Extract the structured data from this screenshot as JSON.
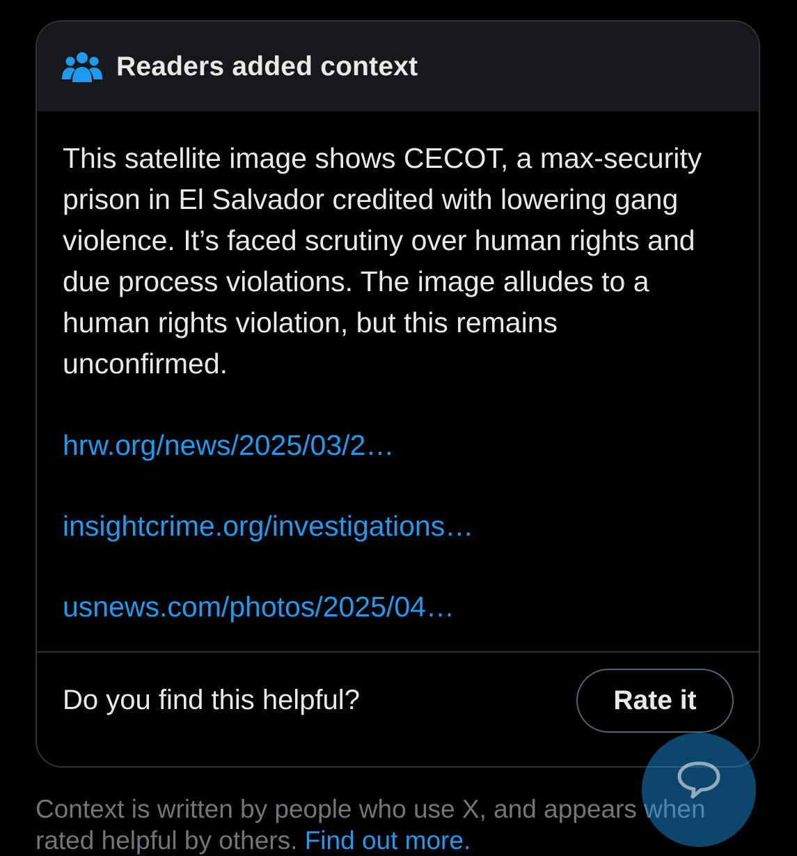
{
  "card": {
    "header": {
      "icon": "people-group-icon",
      "title": "Readers added context"
    },
    "note_text": "This satellite image shows CECOT, a max-security prison in El Salvador credited with lowering gang violence. It’s faced scrutiny over human rights and due process violations. The image alludes to a human rights violation, but this remains unconfirmed.",
    "sources": [
      "hrw.org/news/2025/03/2…",
      "insightcrime.org/investigations…",
      "usnews.com/photos/2025/04…"
    ],
    "footer": {
      "question": "Do you find this helpful?",
      "rate_label": "Rate it"
    }
  },
  "below": {
    "line1": "Context is written by people who use X, and appears when",
    "line2_prefix": "rated helpful by others. ",
    "line2_link": "Find out more."
  },
  "fab": {
    "icon": "message-bubble-icon"
  },
  "colors": {
    "background": "#000000",
    "header_bg": "#16181c",
    "text": "#e7e9ea",
    "muted": "#71767b",
    "link": "#1d9bf0",
    "border": "#2f3336"
  }
}
